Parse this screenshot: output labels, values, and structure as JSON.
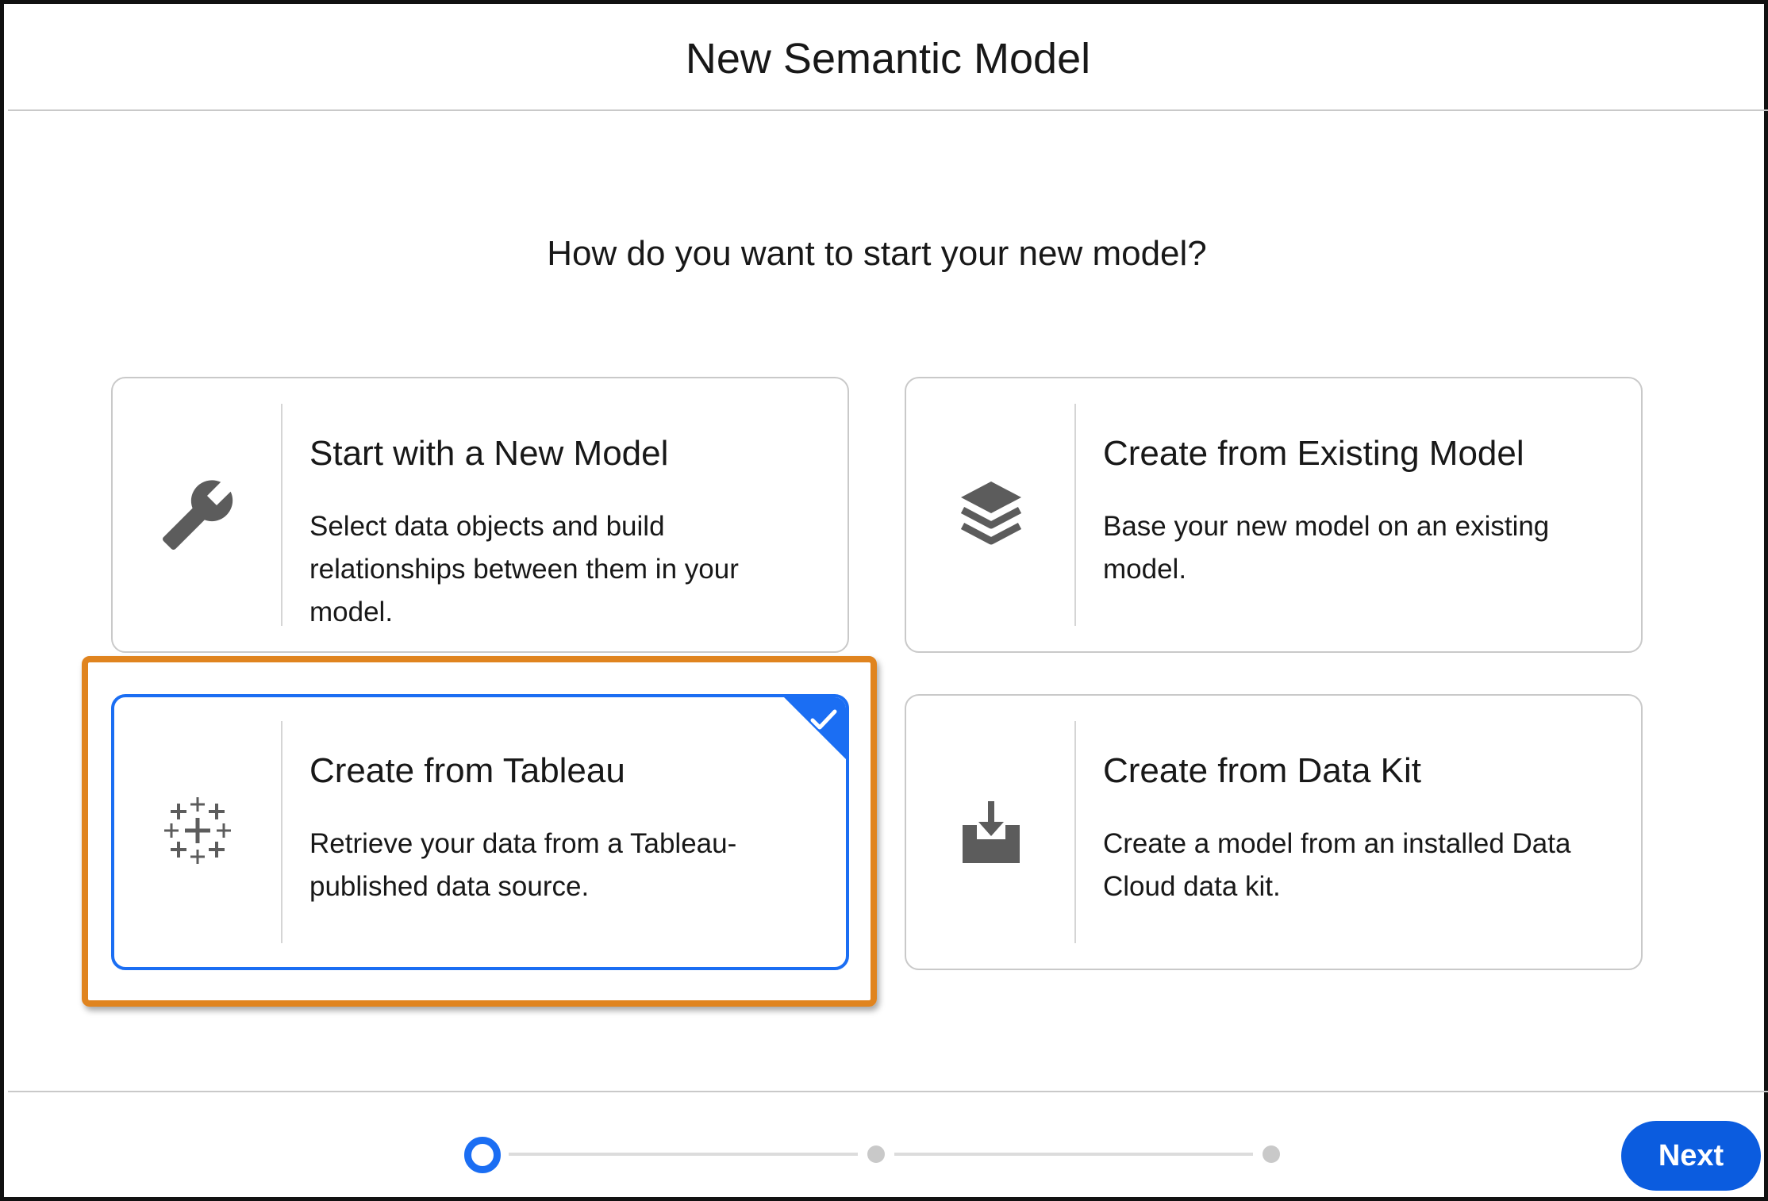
{
  "header": {
    "title": "New Semantic Model"
  },
  "question": "How do you want to start your new model?",
  "cards": [
    {
      "title": "Start with a New Model",
      "description": "Select data objects and build relationships between them in your model.",
      "icon": "wrench-icon",
      "selected": false
    },
    {
      "title": "Create from Existing Model",
      "description": "Base your new model on an existing model.",
      "icon": "layers-icon",
      "selected": false
    },
    {
      "title": "Create from Tableau",
      "description": "Retrieve your data from a Tableau-published data source.",
      "icon": "tableau-logo-icon",
      "selected": true
    },
    {
      "title": "Create from Data Kit",
      "description": "Create a model from an installed Data Cloud data kit.",
      "icon": "download-tray-icon",
      "selected": false
    }
  ],
  "stepper": {
    "total_steps": 3,
    "current_step": 1
  },
  "footer": {
    "next_label": "Next"
  },
  "colors": {
    "accent": "#1b6ef3",
    "button": "#0b5cdf",
    "highlight": "#e0841f",
    "icon": "#5c5c5c"
  }
}
